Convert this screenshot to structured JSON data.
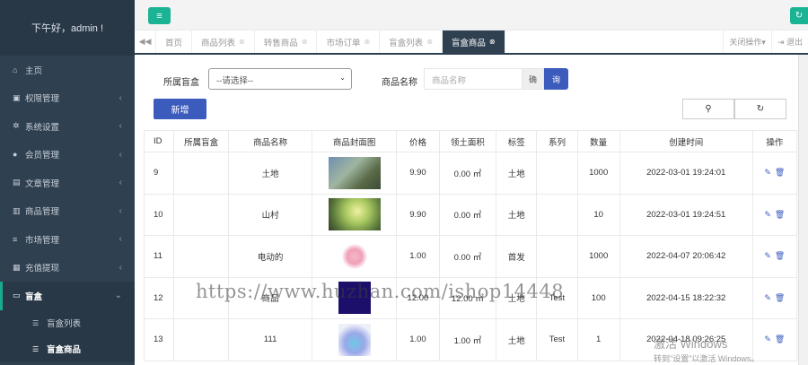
{
  "sidebar": {
    "greeting": "下午好，admin !",
    "items": [
      {
        "icon": "home-icon",
        "glyph": "⌂",
        "label": "主页"
      },
      {
        "icon": "lock-icon",
        "glyph": "▣",
        "label": "权限管理",
        "arrow": "‹"
      },
      {
        "icon": "gear-icon",
        "glyph": "✲",
        "label": "系统设置",
        "arrow": "‹"
      },
      {
        "icon": "user-icon",
        "glyph": "●",
        "label": "会员管理",
        "arrow": "‹"
      },
      {
        "icon": "book-icon",
        "glyph": "▤",
        "label": "文章管理",
        "arrow": "‹"
      },
      {
        "icon": "barcode-icon",
        "glyph": "▥",
        "label": "商品管理",
        "arrow": "‹"
      },
      {
        "icon": "list-icon",
        "glyph": "≡",
        "label": "市场管理",
        "arrow": "‹"
      },
      {
        "icon": "money-icon",
        "glyph": "▦",
        "label": "充值提现",
        "arrow": "‹"
      }
    ],
    "active": {
      "icon": "box-icon",
      "glyph": "▭",
      "label": "盲盒",
      "arrow": "⌄"
    },
    "subitems": [
      {
        "icon": "list-icon",
        "glyph": "☰",
        "label": "盲盒列表"
      },
      {
        "icon": "list-icon",
        "glyph": "☰",
        "label": "盲盒商品"
      }
    ]
  },
  "topbar": {
    "menu_glyph": "≡",
    "refresh_glyph": "↻"
  },
  "tabs": {
    "left_arrow": "◀◀",
    "items": [
      "首页",
      "商品列表",
      "转售商品",
      "市场订单",
      "盲盒列表"
    ],
    "active": "盲盒商品",
    "close_glyph": "⊗",
    "ops": "关闭操作▾",
    "logout": "⇥ 退出"
  },
  "filters": {
    "blindbox_label": "所属盲盒",
    "blindbox_select": "--请选择--",
    "name_label": "商品名称",
    "name_placeholder": "商品名称",
    "addon": "确",
    "search_glyph": "询",
    "add_button": "新增",
    "search_icon_glyph": "🔍",
    "refresh_icon_glyph": "↻"
  },
  "table": {
    "headers": [
      "ID",
      "所属盲盒",
      "商品名称",
      "商品封面图",
      "价格",
      "领土面积",
      "标签",
      "系列",
      "数量",
      "创建时间",
      "操作"
    ],
    "rows": [
      {
        "id": "9",
        "box": "",
        "name": "土地",
        "img": "t1",
        "price": "9.90",
        "area": "0.00 ㎡",
        "tag": "土地",
        "series": "",
        "qty": "1000",
        "created": "2022-03-01 19:24:01"
      },
      {
        "id": "10",
        "box": "",
        "name": "山村",
        "img": "t2",
        "price": "9.90",
        "area": "0.00 ㎡",
        "tag": "土地",
        "series": "",
        "qty": "10",
        "created": "2022-03-01 19:24:51"
      },
      {
        "id": "11",
        "box": "",
        "name": "电动的",
        "img": "t3",
        "price": "1.00",
        "area": "0.00 ㎡",
        "tag": "首发",
        "series": "",
        "qty": "1000",
        "created": "2022-04-07 20:06:42"
      },
      {
        "id": "12",
        "box": "",
        "name": "商品",
        "img": "t4",
        "price": "12.00",
        "area": "12.00 ㎡",
        "tag": "土地",
        "series": "Test",
        "qty": "100",
        "created": "2022-04-15 18:22:32"
      },
      {
        "id": "13",
        "box": "",
        "name": "111",
        "img": "t5",
        "price": "1.00",
        "area": "1.00 ㎡",
        "tag": "土地",
        "series": "Test",
        "qty": "1",
        "created": "2022-04-18 09:26:25"
      }
    ],
    "edit_glyph": "✎",
    "delete_glyph": "🗑"
  },
  "watermark": "https://www.huzhan.com/ishop14448",
  "windows": {
    "activate": "激活 Windows",
    "sub": "转到\"设置\"以激活 Windows。"
  }
}
